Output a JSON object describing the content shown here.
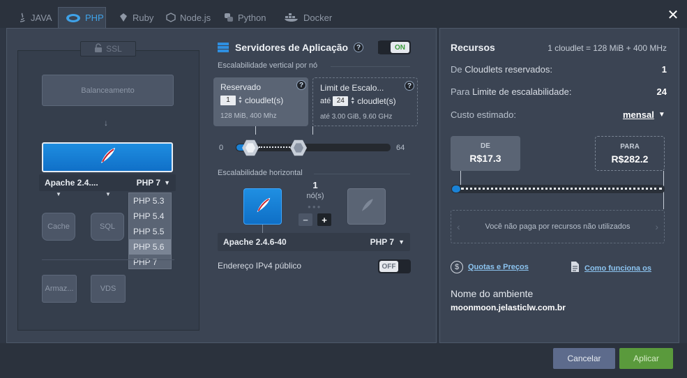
{
  "tabs": [
    {
      "label": "JAVA",
      "icon": "java-icon"
    },
    {
      "label": "PHP",
      "icon": "php-icon"
    },
    {
      "label": "Ruby",
      "icon": "ruby-icon"
    },
    {
      "label": "Node.js",
      "icon": "nodejs-icon"
    },
    {
      "label": "Python",
      "icon": "python-icon"
    },
    {
      "label": "Docker",
      "icon": "docker-icon"
    }
  ],
  "topology": {
    "ssl_label": "SSL",
    "balancer_label": "Balanceamento",
    "node_name": "Apache 2.4....",
    "node_version": "PHP 7",
    "version_options": [
      "PHP 5.3",
      "PHP 5.4",
      "PHP 5.5",
      "PHP 5.6",
      "PHP 7"
    ],
    "highlighted_option": "PHP 5.6",
    "cache_label": "Cache",
    "sql_label": "SQL",
    "storage_label": "Armaz...",
    "vds_label": "VDS"
  },
  "config": {
    "title": "Servidores de Aplicação",
    "toggle_on": "ON",
    "vertical_label": "Escalabilidade vertical por nó",
    "reserved": {
      "title": "Reservado",
      "value": "1",
      "unit": "cloudlet(s)",
      "meta": "128 MiB, 400 Mhz"
    },
    "limit": {
      "title": "Limit de Escalo...",
      "prefix": "até",
      "value": "24",
      "unit": "cloudlet(s)",
      "meta_prefix": "até",
      "meta": "3.00 GiB, 9.60 GHz"
    },
    "slider_min": "0",
    "slider_max": "64",
    "reserved_fraction": 0.016,
    "limit_fraction": 0.375,
    "horizontal_label": "Escalabilidade horizontal",
    "node_count": "1",
    "node_count_unit": "nó(s)",
    "minus": "−",
    "plus": "+",
    "server_name": "Apache 2.4.6-40",
    "server_version": "PHP 7",
    "ipv4_label": "Endereço IPv4 público",
    "toggle_off": "OFF"
  },
  "resources": {
    "title": "Recursos",
    "cloudlet_def": "1 cloudlet = 128 MiB + 400 MHz",
    "reserved_prefix": "De",
    "reserved_label": "Cloudlets reservados:",
    "reserved_value": "1",
    "limit_prefix": "Para",
    "limit_label": "Limite de escalabilidade:",
    "limit_value": "24",
    "cost_label": "Custo estimado:",
    "period": "mensal",
    "from_label": "DE",
    "from_value": "R$17.3",
    "to_label": "PARA",
    "to_value": "R$282.2",
    "notice": "Você não paga por recursos não utilizados",
    "quotas_link": "Quotas e Preços",
    "howto_link": "Como funciona os",
    "env_name_label": "Nome do ambiente",
    "env_name": "moonmoon.jelasticlw.com.br"
  },
  "footer": {
    "cancel": "Cancelar",
    "apply": "Aplicar"
  },
  "colors": {
    "accent": "#1a82d6",
    "apply_green": "#5a9a3c",
    "cancel_blue": "#5d6b8c"
  }
}
